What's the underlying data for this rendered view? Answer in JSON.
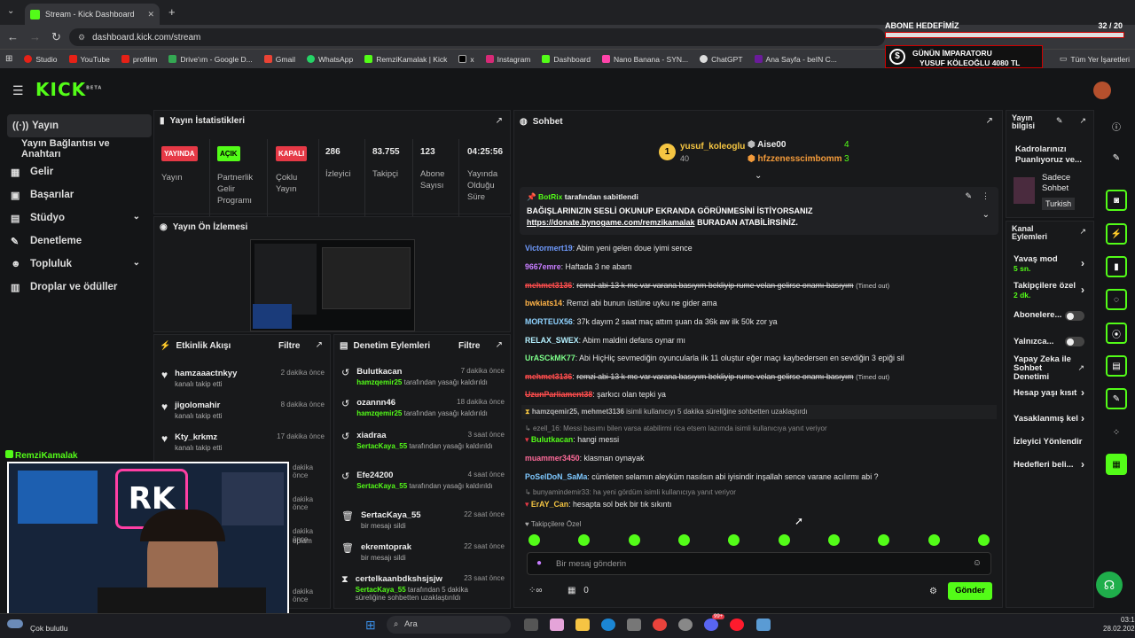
{
  "browser": {
    "tab_title": "Stream - Kick Dashboard",
    "url": "dashboard.kick.com/stream",
    "bookmarks": [
      "Studio",
      "YouTube",
      "profilim",
      "Drive'ım - Google D...",
      "Gmail",
      "WhatsApp",
      "RemziKamalak | Kick",
      "x",
      "Instagram",
      "Dashboard",
      "Nano Banana - SYN...",
      "ChatGPT",
      "Ana Sayfa - beIN C..."
    ],
    "all_bookmarks": "Tüm Yer İşaretleri"
  },
  "overlay": {
    "goal_label": "ABONE HEDEFİMİZ",
    "goal_count": "32 / 20",
    "goal_progress": 1.0,
    "emperor_label": "GÜNÜN İMPARATORU",
    "emperor_value": "YUSUF KÖLEOĞLU 4080 TL"
  },
  "header": {
    "logo": "KICK",
    "beta": "BETA"
  },
  "sidebar": {
    "items": [
      {
        "label": "Yayın"
      },
      {
        "label": "Yayın Bağlantısı ve Anahtarı"
      },
      {
        "label": "Gelir"
      },
      {
        "label": "Başarılar"
      },
      {
        "label": "Stüdyo"
      },
      {
        "label": "Denetleme"
      },
      {
        "label": "Topluluk"
      },
      {
        "label": "Droplar ve ödüller"
      }
    ]
  },
  "stats": {
    "title": "Yayın İstatistikleri",
    "badges": [
      "YAYINDA",
      "AÇIK",
      "KAPALI"
    ],
    "labels": [
      "Yayın",
      "Partnerlik Gelir Programı",
      "Çoklu Yayın"
    ],
    "values": [
      {
        "v": "286",
        "l": "İzleyici"
      },
      {
        "v": "83.755",
        "l": "Takipçi"
      },
      {
        "v": "123",
        "l": "Abone Sayısı"
      },
      {
        "v": "04:25:56",
        "l": "Yayında Olduğu Süre"
      }
    ]
  },
  "preview": {
    "title": "Yayın Ön İzlemesi"
  },
  "activity": {
    "title": "Etkinlik Akışı",
    "filter": "Filtre",
    "items": [
      {
        "name": "hamzaaactnkyy",
        "sub": "kanalı takip etti",
        "time": "2 dakika önce"
      },
      {
        "name": "jigolomahir",
        "sub": "kanalı takip etti",
        "time": "8 dakika önce"
      },
      {
        "name": "Kty_krkmz",
        "sub": "kanalı takip etti",
        "time": "17 dakika önce"
      }
    ],
    "hidden_times": [
      "dakika önce",
      "dakika önce",
      "dakika önce",
      "dakika önce"
    ],
    "partial": "oplam"
  },
  "webcam": {
    "name": "RemziKamalak",
    "logo": "RK"
  },
  "moderation": {
    "title": "Denetim Eylemleri",
    "filter": "Filtre",
    "items": [
      {
        "name": "Bulutkacan",
        "by": "hamzqemir25",
        "rest": "tarafından yasağı kaldırıldı",
        "time": "7 dakika önce"
      },
      {
        "name": "ozannn46",
        "by": "hamzqemir25",
        "rest": "tarafından yasağı kaldırıldı",
        "time": "18 dakika önce"
      },
      {
        "name": "xiadraa",
        "by": "SertacKaya_55",
        "rest": "tarafından yasağı kaldırıldı",
        "time": "3 saat önce"
      },
      {
        "name": "Efe24200",
        "by": "SertacKaya_55",
        "rest": "tarafından yasağı kaldırıldı",
        "time": "4 saat önce"
      },
      {
        "name": "SertacKaya_55",
        "by": "",
        "rest": "bir mesajı sildi",
        "time": "22 saat önce"
      },
      {
        "name": "ekremtoprak",
        "by": "",
        "rest": "bir mesajı sildi",
        "time": "22 saat önce"
      },
      {
        "name": "certelkaanbdkshsjsjw",
        "by": "SertacKaya_55",
        "rest": "tarafından 5 dakika süreliğine sohbetten uzaklaştırıldı",
        "time": "23 saat önce"
      }
    ]
  },
  "chat": {
    "title": "Sohbet",
    "top_gifters": [
      {
        "rank": "1",
        "name": "yusuf_koleoglu",
        "val": "40"
      },
      {
        "name": "Aise00",
        "val": "4"
      },
      {
        "name": "hfzzenesscimbomm",
        "val": "3"
      }
    ],
    "pinned": {
      "by": "BotRix",
      "by_rest": "tarafından sabitlendi",
      "line1": "BAĞIŞLARINIZIN SESLİ OKUNUP EKRANDA GÖRÜNMESİNİ İSTİYORSANIZ",
      "link": "https://donate.bynogame.com/remzikamalak",
      "line2": "BURADAN ATABİLİRSİNİZ."
    },
    "messages": [
      {
        "u": "Victormert19",
        "c": "#6f9bff",
        "t": "Abim yeni gelen doue iyimi sence"
      },
      {
        "u": "9667emre",
        "c": "#c77dff",
        "t": "Haftada 3 ne abartı"
      },
      {
        "u": "mehmet3136",
        "c": "#ff4d4d",
        "t": "remzi abi 13 k mc var varana basıyım bekliyip rume velan gelirse onamı basıyım",
        "to": "(Timed out)"
      },
      {
        "u": "bwkiats14",
        "c": "#ffb347",
        "t": "Remzi abi bunun üstüne uyku ne gider ama"
      },
      {
        "u": "MORTEUX56",
        "c": "#8fd3ff",
        "t": "37k dayım 2 saat maç attım şuan da 36k aw ilk 50k zor ya"
      },
      {
        "u": "RELAX_SWEX",
        "c": "#b4f0ff",
        "t": "Abim maldini defans oynar mı"
      },
      {
        "u": "UrASCkMK77",
        "c": "#7dff8a",
        "t": "Abi HiçHiç sevmediğin oyuncularla ilk 11 oluştur eğer maçı kaybedersen en sevdiğin 3 epiği sil"
      },
      {
        "u": "mehmet3136",
        "c": "#ff4d4d",
        "t": "remzi abi 13 k mc var varana basıyım bekliyip rume velan gelirse onamı basıyım",
        "to": "(Timed out)"
      },
      {
        "u": "UzunParliament38",
        "c": "#ff4d4d",
        "t": "şarkıcı olan tepki ya"
      }
    ],
    "system": {
      "a": "hamzqemir25, mehmet3136",
      "rest": "isimli kullanıcıyı 5 dakika süreliğine sohbetten uzaklaştırdı"
    },
    "reply1": {
      "ctx": "ezell_16: Messi basımı bilen varsa atabilirmi rica etsem lazımda isimli kullanıcıya yanıt veriyor",
      "u": "Bulutkacan",
      "t": "hangi messi"
    },
    "m2": [
      {
        "u": "muammer3450",
        "c": "#ff6b9a",
        "t": "klasman oynayak"
      },
      {
        "u": "PoSelDoN_SaMa",
        "c": "#7ec8ff",
        "t": "cümleten selamın aleyküm nasılsın abi iyisindir inşallah sence varane acılırmı abi ?"
      }
    ],
    "reply2": {
      "ctx": "bunyamindemir33: ha yeni gördüm isimli kullanıcıya yanıt veriyor",
      "u": "ErAY_Can",
      "t": "hesapta sol bek bir tık sıkıntı"
    },
    "followers_only": "Takipçilere Özel",
    "placeholder": "Bir mesaj gönderin",
    "send": "Gönder",
    "count": "0"
  },
  "right": {
    "info_title": "Yayın bilgisi",
    "title": "Kadrolarınızı Puanlıyoruz ve...",
    "mode": "Sadece Sohbet",
    "lang": "Turkish",
    "actions_title": "Kanal Eylemleri",
    "slow": "Yavaş mod",
    "slow_v": "5 sn.",
    "fol": "Takipçilere özel",
    "fol_v": "2 dk.",
    "subs": "Abonelere...",
    "emote": "Yalnızca...",
    "ai": "Yapay Zeka ile Sohbet Denetimi",
    "age": "Hesap yaşı kısıt",
    "words": "Yasaklanmış kel",
    "raid": "İzleyici Yönlendir",
    "goals": "Hedefleri beli..."
  },
  "taskbar": {
    "weather": "Çok bulutlu",
    "search": "Ara",
    "time": "03:10",
    "date": "28.02.2026",
    "badge": "99+"
  },
  "colors": {
    "accent": "#53fc18",
    "red": "#e63946"
  }
}
